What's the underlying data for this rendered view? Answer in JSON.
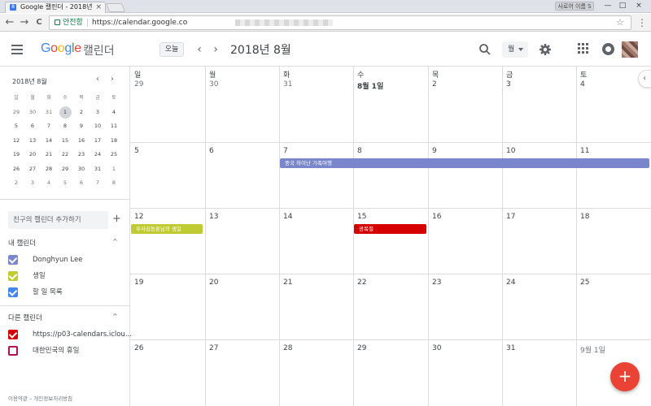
{
  "browser": {
    "tab_title": "Google 캘린더 - 2018년",
    "tab_close": "×",
    "profile_label": "사로어 이름 S",
    "window_controls": [
      "—",
      "□",
      "×"
    ],
    "nav": {
      "back": "←",
      "forward": "→",
      "reload": "C"
    },
    "secure_label": "안전함",
    "url": "https://calendar.google.co",
    "star": "☆",
    "menu": "⋮"
  },
  "header": {
    "logo_parts": [
      "G",
      "o",
      "o",
      "g",
      "l",
      "e"
    ],
    "product": "캘린더",
    "today_label": "오늘",
    "prev": "‹",
    "next": "›",
    "period_title": "2018년 8월",
    "view_label": "월"
  },
  "sidebar": {
    "mini_calendar": {
      "title": "2018년 8월",
      "prev": "‹",
      "next": "›",
      "weekday_headers": [
        "일",
        "월",
        "화",
        "수",
        "목",
        "금",
        "토"
      ],
      "weeks": [
        [
          "29",
          "30",
          "31",
          "1",
          "2",
          "3",
          "4"
        ],
        [
          "5",
          "6",
          "7",
          "8",
          "9",
          "10",
          "11"
        ],
        [
          "12",
          "13",
          "14",
          "15",
          "16",
          "17",
          "18"
        ],
        [
          "19",
          "20",
          "21",
          "22",
          "23",
          "24",
          "25"
        ],
        [
          "26",
          "27",
          "28",
          "29",
          "30",
          "31",
          "1"
        ],
        [
          "2",
          "3",
          "4",
          "5",
          "6",
          "7",
          "8"
        ]
      ],
      "selected_day": "1"
    },
    "add_friend_placeholder": "친구의 캘린더 추가하기",
    "add_icon": "+",
    "my_calendars_title": "내 캘린더",
    "my_calendars": [
      {
        "label": "Donghyun Lee",
        "color": "#7986cb",
        "checked": true
      },
      {
        "label": "생일",
        "color": "#c0ca33",
        "checked": true
      },
      {
        "label": "할 일 목록",
        "color": "#4285f4",
        "checked": true
      }
    ],
    "other_calendars_title": "다른 캘린더",
    "other_calendars": [
      {
        "label": "https://p03-calendars.iclou...",
        "color": "#d50000",
        "checked": true
      },
      {
        "label": "대한민국의 휴일",
        "color": "#ad1457",
        "checked": false
      }
    ],
    "section_caret": "^",
    "footer": "이용약관 – 개인정보처리방침"
  },
  "grid": {
    "weekdays": [
      "일",
      "월",
      "화",
      "수",
      "목",
      "금",
      "토"
    ],
    "weeks": [
      [
        "29",
        "30",
        "31",
        "8월 1일",
        "2",
        "3",
        "4"
      ],
      [
        "5",
        "6",
        "7",
        "8",
        "9",
        "10",
        "11"
      ],
      [
        "12",
        "13",
        "14",
        "15",
        "16",
        "17",
        "18"
      ],
      [
        "19",
        "20",
        "21",
        "22",
        "23",
        "24",
        "25"
      ],
      [
        "26",
        "27",
        "28",
        "29",
        "30",
        "31",
        "9월 1일"
      ]
    ],
    "events": [
      {
        "title": "중국 하이난 가족여행",
        "color": "#7986cb"
      },
      {
        "title": "우사김동훈님의 생일",
        "color": "#c0ca33"
      },
      {
        "title": "광복절",
        "color": "#d50000"
      }
    ]
  },
  "collapse_icon": "‹",
  "fab_label": "+"
}
